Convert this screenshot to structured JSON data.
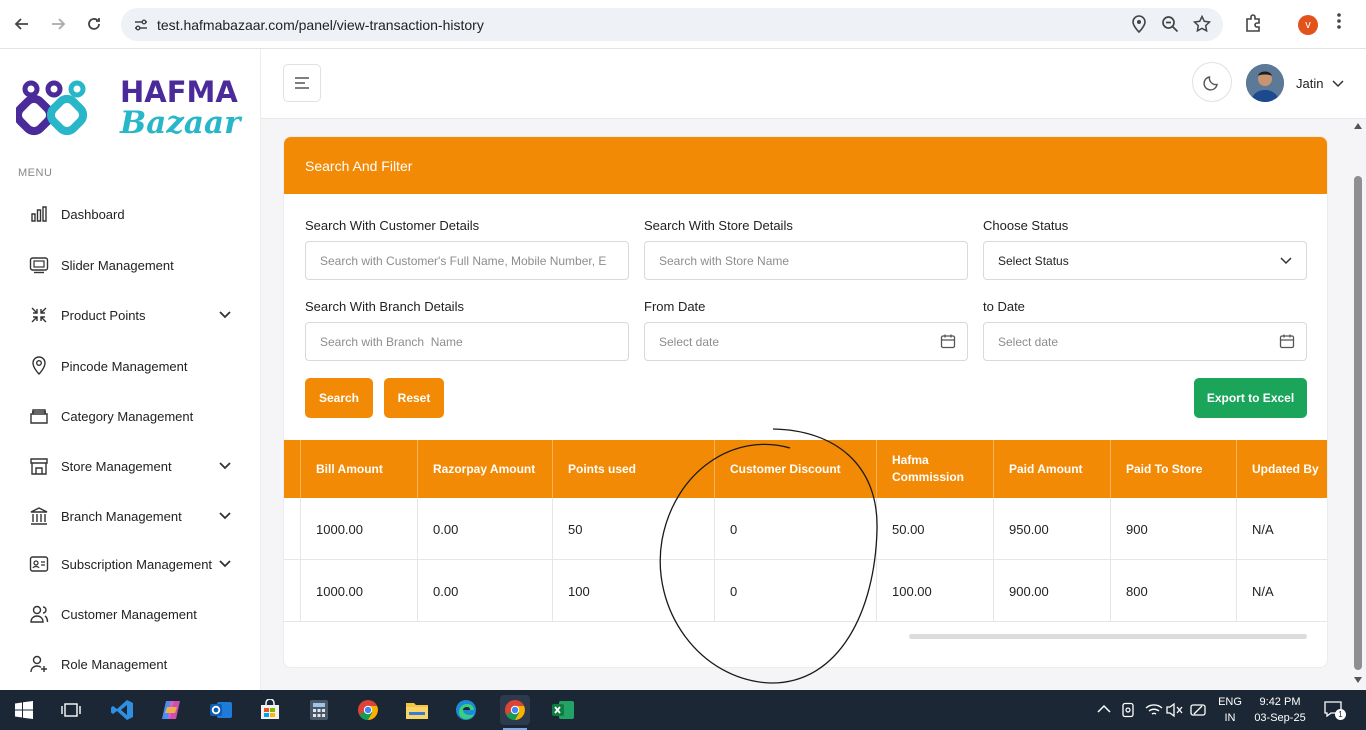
{
  "browser": {
    "url": "test.hafmabazaar.com/panel/view-transaction-history",
    "profile_initial": "v"
  },
  "brand": {
    "name_top": "HAFMA",
    "name_bottom": "Bazaar",
    "colors": {
      "purple": "#4b2a99",
      "teal": "#27b7c9",
      "orange": "#f28a05",
      "green": "#1aa55a"
    }
  },
  "sidebar": {
    "caption": "MENU",
    "items": [
      {
        "label": "Dashboard",
        "icon": "bar-chart-icon",
        "has_children": false
      },
      {
        "label": "Slider Management",
        "icon": "slider-icon",
        "has_children": false
      },
      {
        "label": "Product Points",
        "icon": "compress-arrows-icon",
        "has_children": true
      },
      {
        "label": "Pincode Management",
        "icon": "location-pin-icon",
        "has_children": false
      },
      {
        "label": "Category Management",
        "icon": "box-icon",
        "has_children": false
      },
      {
        "label": "Store Management",
        "icon": "store-icon",
        "has_children": true
      },
      {
        "label": "Branch Management",
        "icon": "bank-icon",
        "has_children": true
      },
      {
        "label": "Subscription Management",
        "icon": "id-card-icon",
        "has_children": true
      },
      {
        "label": "Customer Management",
        "icon": "users-icon",
        "has_children": false
      },
      {
        "label": "Role Management",
        "icon": "user-plus-icon",
        "has_children": false
      }
    ]
  },
  "header": {
    "user_name": "Jatin"
  },
  "filter": {
    "title": "Search And Filter",
    "customer_label": "Search With Customer Details",
    "customer_placeholder": "Search with Customer's Full Name, Mobile Number, E",
    "store_label": "Search With Store Details",
    "store_placeholder": "Search with Store Name",
    "status_label": "Choose Status",
    "status_value": "Select Status",
    "branch_label": "Search With Branch Details",
    "branch_placeholder": "Search with Branch  Name",
    "from_label": "From Date",
    "from_placeholder": "Select date",
    "to_label": "to Date",
    "to_placeholder": "Select date",
    "search_button": "Search",
    "reset_button": "Reset",
    "export_button": "Export to Excel"
  },
  "table": {
    "columns": [
      "Bill Amount",
      "Razorpay Amount",
      "Points used",
      "Customer Discount",
      "Hafma Commission",
      "Paid Amount",
      "Paid To Store",
      "Updated By"
    ],
    "rows": [
      [
        "1000.00",
        "0.00",
        "50",
        "0",
        "50.00",
        "950.00",
        "900",
        "N/A"
      ],
      [
        "1000.00",
        "0.00",
        "100",
        "0",
        "100.00",
        "900.00",
        "800",
        "N/A"
      ]
    ]
  },
  "taskbar": {
    "language_top": "ENG",
    "language_bottom": "IN",
    "time": "9:42 PM",
    "date": "03-Sep-25",
    "notification_count": "1"
  }
}
